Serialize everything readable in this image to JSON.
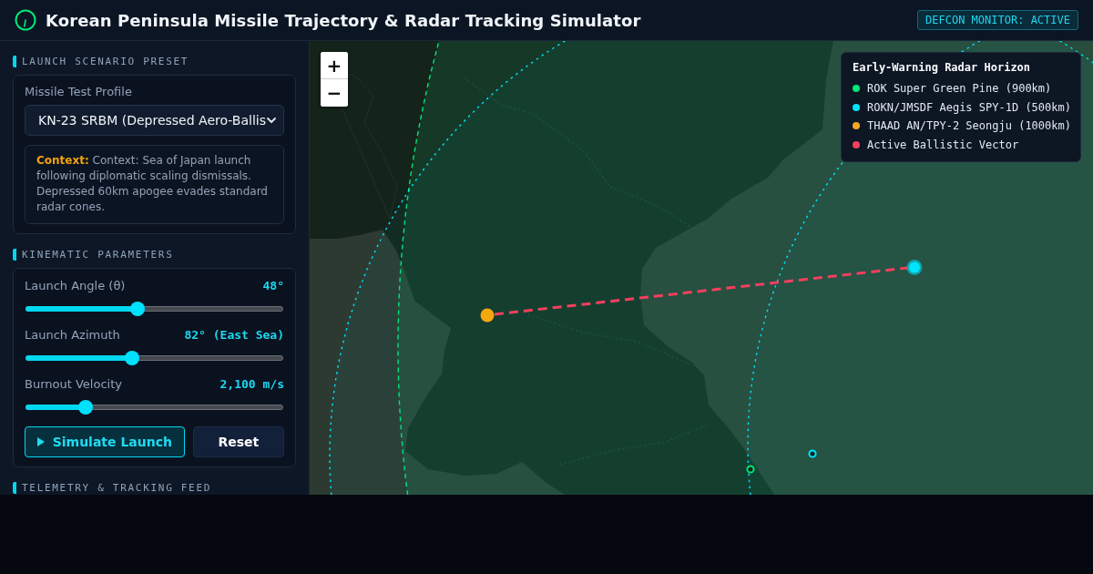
{
  "header": {
    "title": "Korean Peninsula Missile Trajectory & Radar Tracking Simulator",
    "status_badge": "DEFCON MONITOR: ACTIVE"
  },
  "scenario_section": {
    "heading": "LAUNCH SCENARIO PRESET",
    "field_label": "Missile Test Profile",
    "profile_select": {
      "value": "KN-23 SRBM (Depressed Aero-Ballis"
    },
    "context_note": "**Context:** Context: Sea of Japan launch following diplomatic scaling dismissals. Depressed 60km apogee evades standard radar cones."
  },
  "kinematics_section": {
    "heading": "KINEMATIC PARAMETERS",
    "sliders": [
      {
        "label": "Launch Angle (θ)",
        "reading": "48°",
        "level": 0.43
      },
      {
        "label": "Launch Azimuth",
        "reading": "82° (East Sea)",
        "level": 0.41
      },
      {
        "label": "Burnout Velocity",
        "reading": "2,100 m/s",
        "level": 0.22
      }
    ],
    "buttons": [
      {
        "label": "Simulate Launch",
        "kind": "primary"
      },
      {
        "label": "Reset",
        "kind": "secondary"
      }
    ]
  },
  "telemetry_section": {
    "heading": "TELEMETRY & TRACKING FEED"
  },
  "map": {
    "zoom_controls": [
      "+",
      "−"
    ],
    "legend": {
      "title": "Early-Warning Radar Horizon",
      "items": [
        {
          "label": "ROK Super Green Pine (900km)",
          "color": "#00e676"
        },
        {
          "label": "ROKN/JMSDF Aegis SPY-1D (500km)",
          "color": "#00e5ff"
        },
        {
          "label": "THAAD AN/TPY-2 Seongju (1000km)",
          "color": "#f5a623"
        },
        {
          "label": "Active Ballistic Vector",
          "color": "#f43f5e"
        }
      ]
    }
  }
}
